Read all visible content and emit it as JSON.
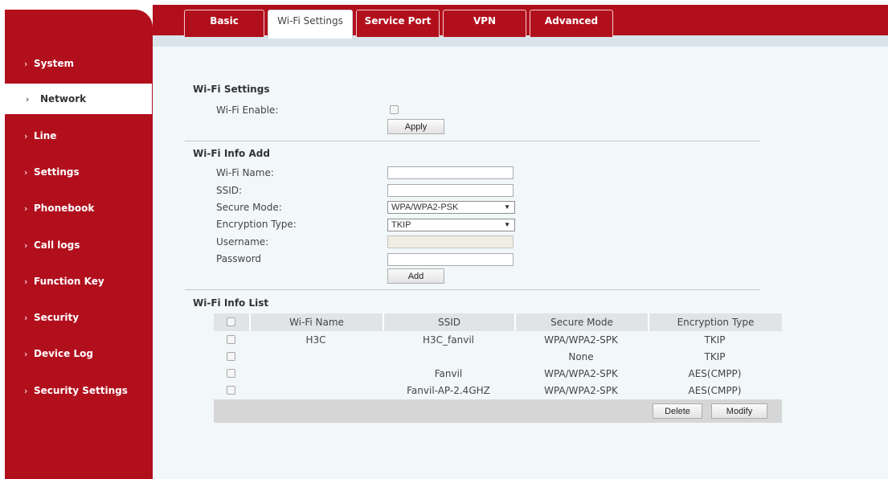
{
  "sidebar": {
    "items": [
      {
        "label": "System"
      },
      {
        "label": "Network"
      },
      {
        "label": "Line"
      },
      {
        "label": "Settings"
      },
      {
        "label": "Phonebook"
      },
      {
        "label": "Call logs"
      },
      {
        "label": "Function Key"
      },
      {
        "label": "Security"
      },
      {
        "label": "Device Log"
      },
      {
        "label": "Security Settings"
      }
    ],
    "active": "Network",
    "chevron": "›"
  },
  "tabs": [
    {
      "label": "Basic"
    },
    {
      "label": "Wi-Fi Settings"
    },
    {
      "label": "Service Port"
    },
    {
      "label": "VPN"
    },
    {
      "label": "Advanced"
    }
  ],
  "active_tab": "Wi-Fi Settings",
  "wifi_settings": {
    "title": "Wi-Fi Settings",
    "enable_label": "Wi-Fi Enable:",
    "enabled": false,
    "apply_label": "Apply"
  },
  "wifi_add": {
    "title": "Wi-Fi Info Add",
    "name_label": "Wi-Fi Name:",
    "name_value": "",
    "ssid_label": "SSID:",
    "ssid_value": "",
    "secure_label": "Secure Mode:",
    "secure_value": "WPA/WPA2-PSK",
    "enc_label": "Encryption Type:",
    "enc_value": "TKIP",
    "username_label": "Username:",
    "username_value": "",
    "password_label": "Password",
    "password_value": "",
    "add_label": "Add",
    "select_arrow": "▼"
  },
  "wifi_list": {
    "title": "Wi-Fi Info List",
    "headers": {
      "name": "Wi-Fi Name",
      "ssid": "SSID",
      "secure": "Secure Mode",
      "enc": "Encryption Type"
    },
    "rows": [
      {
        "name": "H3C",
        "ssid": "H3C_fanvil",
        "secure": "WPA/WPA2-SPK",
        "enc": "TKIP"
      },
      {
        "name": "",
        "ssid": "",
        "secure": "None",
        "enc": "TKIP"
      },
      {
        "name": "",
        "ssid": "Fanvil",
        "secure": "WPA/WPA2-SPK",
        "enc": "AES(CMPP)"
      },
      {
        "name": "",
        "ssid": "Fanvil-AP-2.4GHZ",
        "secure": "WPA/WPA2-SPK",
        "enc": "AES(CMPP)"
      }
    ],
    "delete_label": "Delete",
    "modify_label": "Modify"
  },
  "colors": {
    "brand_red": "#b20f1d",
    "content_bg": "#f2f7fa",
    "table_header": "#e1e4e6",
    "table_footer": "#d6d6d6"
  }
}
